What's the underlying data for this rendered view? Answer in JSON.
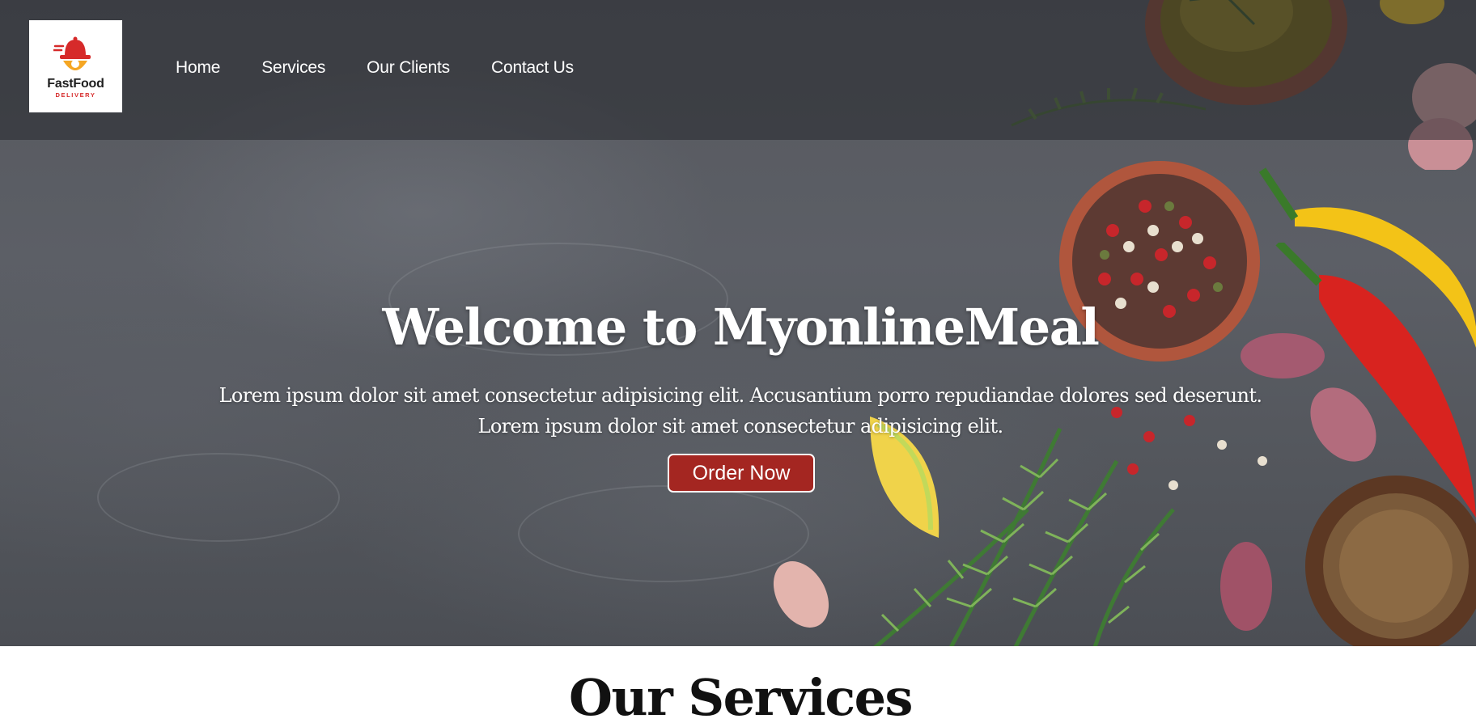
{
  "logo": {
    "name": "FastFood",
    "subtitle": "DELIVERY"
  },
  "nav": {
    "items": [
      "Home",
      "Services",
      "Our Clients",
      "Contact Us"
    ]
  },
  "hero": {
    "title": "Welcome to MyonlineMeal",
    "line1": "Lorem ipsum dolor sit amet consectetur adipisicing elit. Accusantium porro repudiandae dolores sed deserunt.",
    "line2": "Lorem ipsum dolor sit amet consectetur adipisicing elit.",
    "button": "Order Now"
  },
  "services": {
    "title": "Our Services"
  },
  "colors": {
    "button_bg": "#a42621",
    "logo_red": "#d62a2a",
    "logo_orange": "#f5a623",
    "hero_overlay": "#26282e"
  }
}
